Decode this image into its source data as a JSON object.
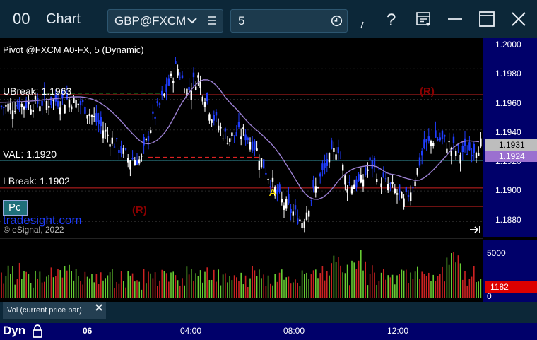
{
  "window": {
    "icon_label": "00",
    "title": "Chart",
    "symbol": "GBP@FXCM",
    "interval": "5"
  },
  "chart_data": {
    "type": "candlestick",
    "study_title": "Pivot @FXCM A0-FX, 5 (Dynamic)",
    "ylim": [
      1.187,
      1.2
    ],
    "ylim_labels": [
      "1.2000",
      "1.1980",
      "1.1960",
      "1.1940",
      "1.1920",
      "1.1900",
      "1.1880"
    ],
    "x_labels": [
      "06",
      "04:00",
      "08:00",
      "12:00"
    ],
    "levels": {
      "upper_break_label": "UBreak: 1.1963",
      "val_label": "VAL: 1.1920",
      "lower_break_label": "LBreak: 1.1902",
      "pivot": 1.1991,
      "upper_break": 1.1963,
      "val": 1.192,
      "lower_break": 1.1902
    },
    "markers": [
      "(R)",
      "(R)",
      "A"
    ],
    "last_price": "1.1931",
    "ma_value": "1.1924",
    "volume": {
      "label": "Vol (current price bar)",
      "tick": "5000",
      "zero": "0",
      "last": "1182"
    },
    "watermark": "tradesight.com",
    "copyright": "© eSignal, 2022",
    "pc_button": "Pc",
    "dyn_label": "Dyn"
  },
  "colors": {
    "bull": "#ffffff",
    "bear": "#1f3dff",
    "ma": "#9a7fd0",
    "up_vol": "#66cc33",
    "down_vol": "#cc2222",
    "axis": "#00006a"
  }
}
